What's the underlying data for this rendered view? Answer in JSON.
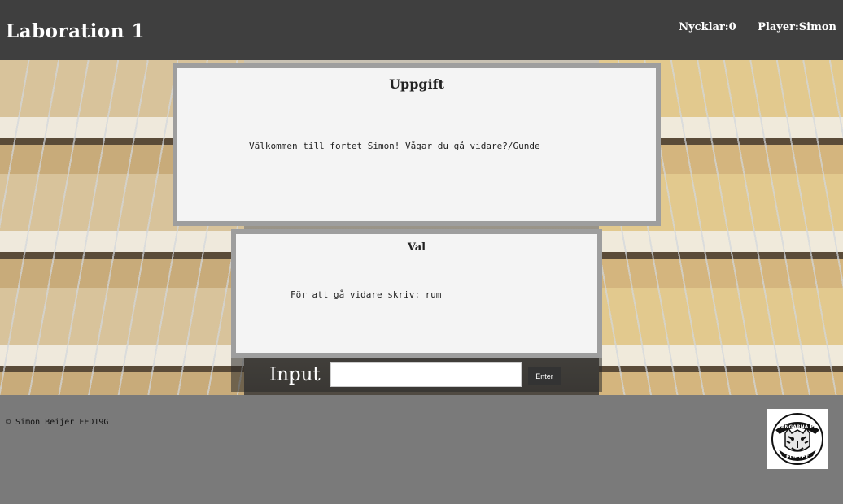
{
  "header": {
    "title": "Laboration 1",
    "keys": "Nycklar:0",
    "player": "Player:Simon"
  },
  "task_panel": {
    "title": "Uppgift",
    "text": "Välkommen till fortet Simon! Vågar du gå vidare?/Gunde"
  },
  "choice_panel": {
    "title": "Val",
    "text": "För att gå vidare skriv: rum"
  },
  "input": {
    "label": "Input",
    "value": "",
    "button": "Enter"
  },
  "footer": {
    "copyright": "© Simon Beijer FED19G",
    "logo_top": "FÅNGARNA PÅ",
    "logo_bottom": "FORTET"
  }
}
